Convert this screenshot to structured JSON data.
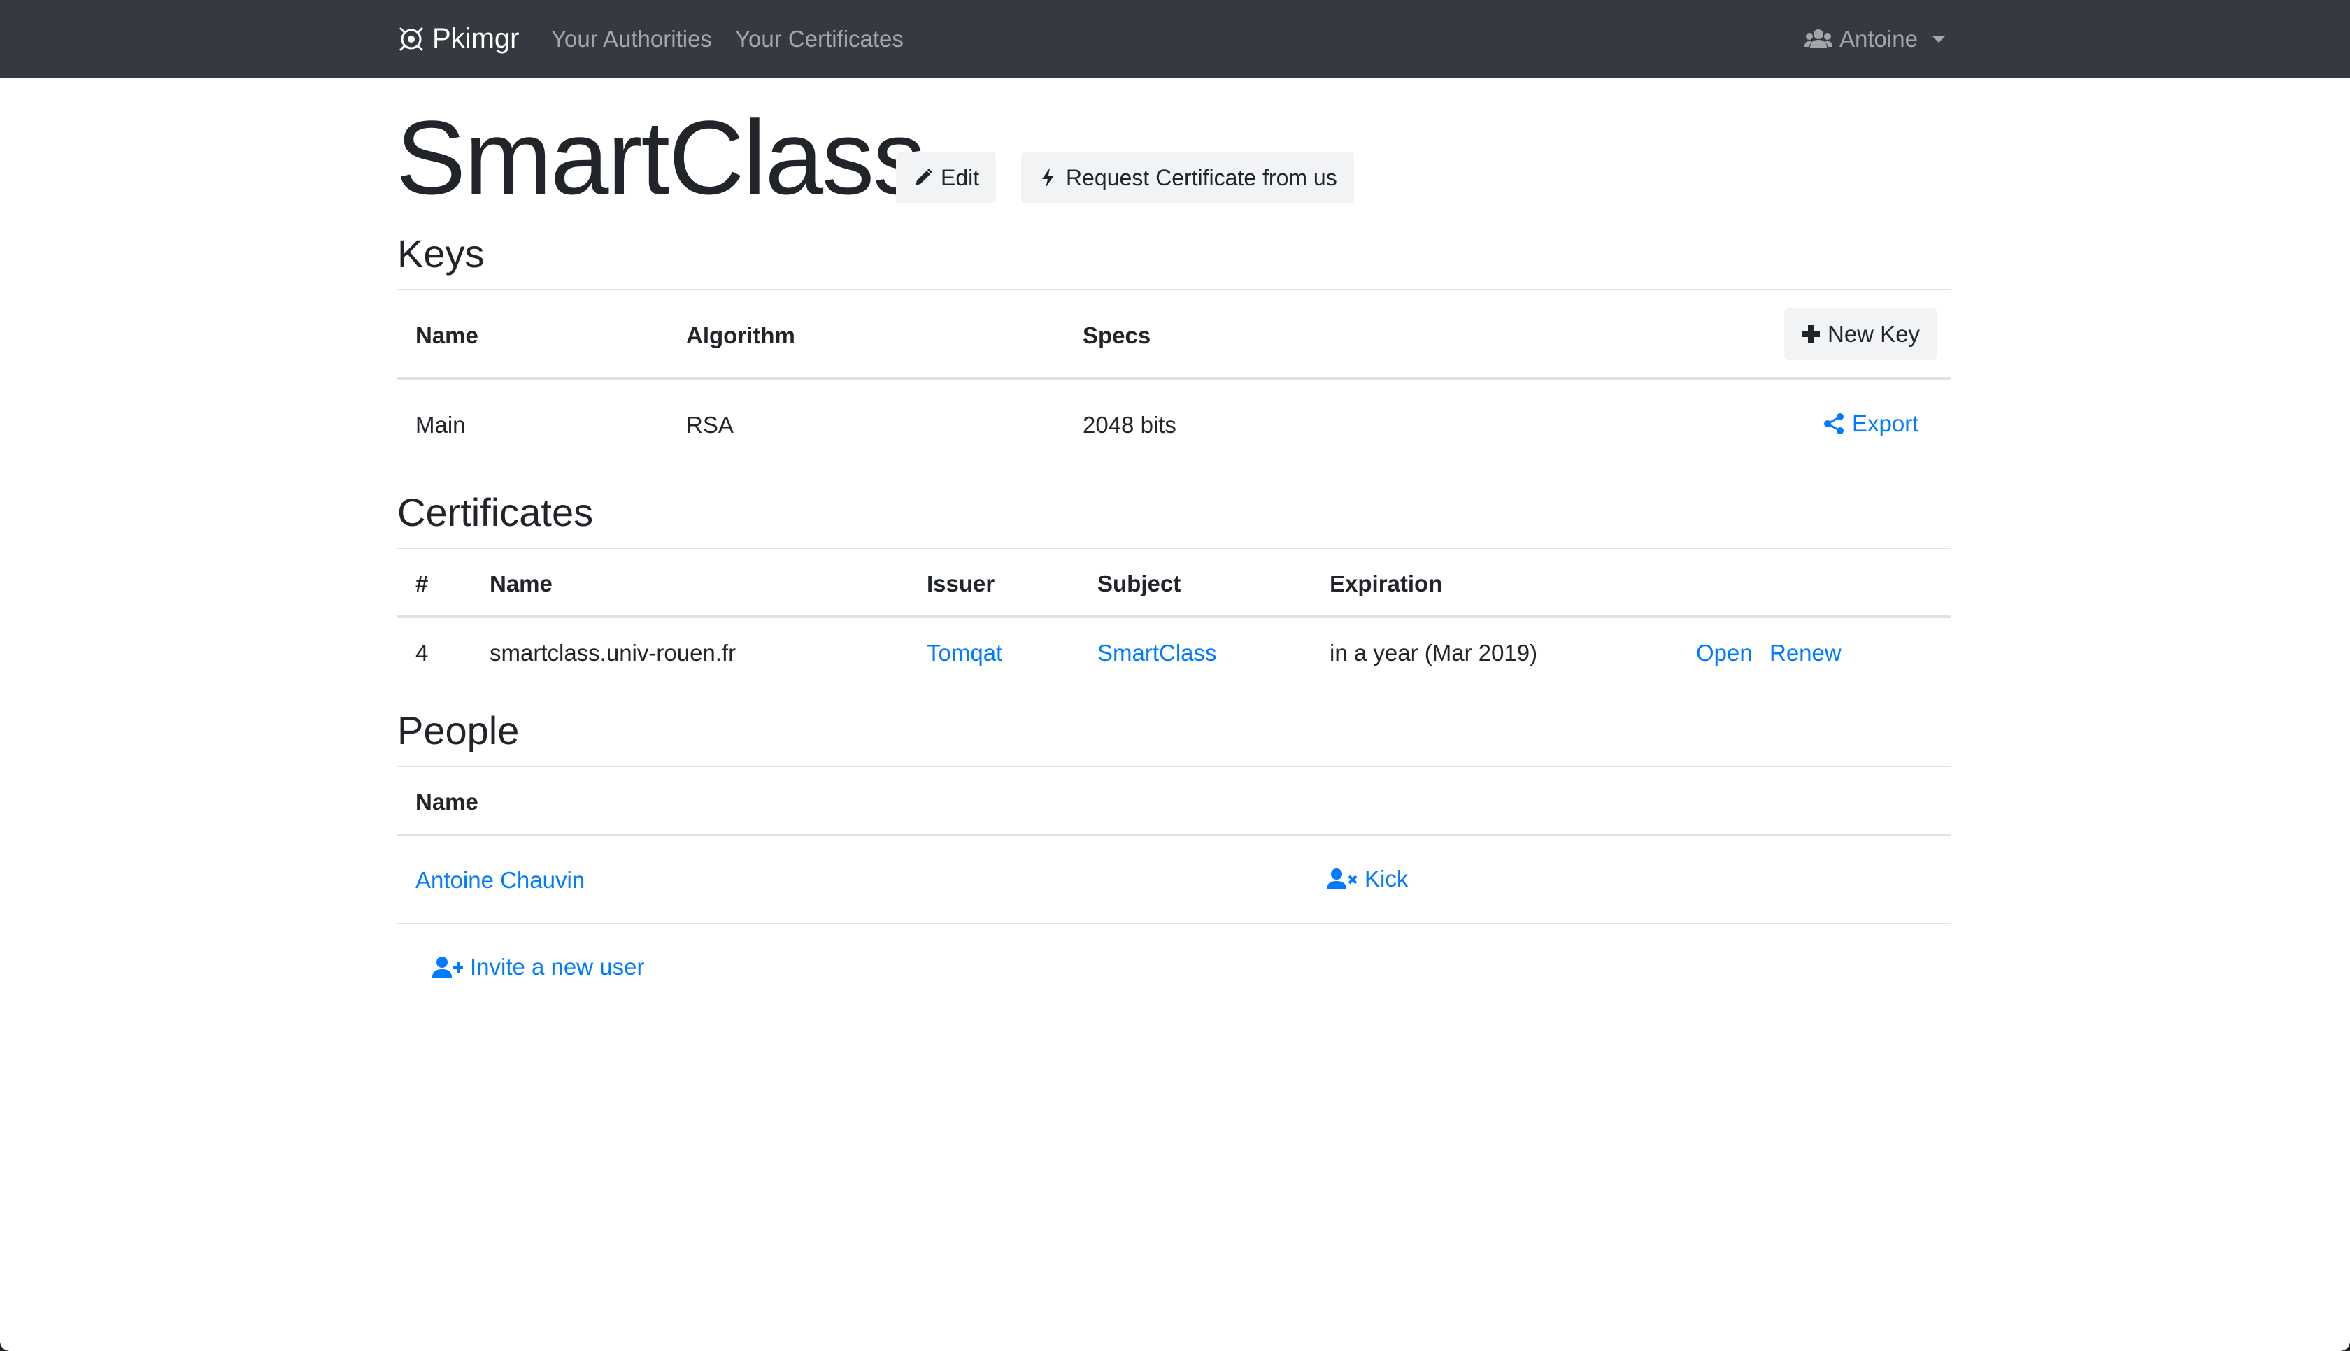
{
  "navbar": {
    "brand": "Pkimgr",
    "links": [
      "Your Authorities",
      "Your Certificates"
    ],
    "user": "Antoine"
  },
  "page": {
    "title": "SmartClass",
    "edit_label": "Edit",
    "request_label": "Request Certificate from us"
  },
  "keys": {
    "heading": "Keys",
    "columns": [
      "Name",
      "Algorithm",
      "Specs"
    ],
    "new_key_label": "New Key",
    "rows": [
      {
        "name": "Main",
        "algorithm": "RSA",
        "specs": "2048 bits",
        "action": "Export"
      }
    ]
  },
  "certificates": {
    "heading": "Certificates",
    "columns": [
      "#",
      "Name",
      "Issuer",
      "Subject",
      "Expiration"
    ],
    "rows": [
      {
        "number": "4",
        "name": "smartclass.univ-rouen.fr",
        "issuer": "Tomqat",
        "subject": "SmartClass",
        "expiration": "in a year (Mar 2019)",
        "open": "Open",
        "renew": "Renew"
      }
    ]
  },
  "people": {
    "heading": "People",
    "columns": [
      "Name"
    ],
    "rows": [
      {
        "name": "Antoine Chauvin",
        "action": "Kick"
      }
    ],
    "invite_label": "Invite a new user"
  },
  "icons": {
    "brand": "robot-icon",
    "user_menu": "users-icon",
    "edit": "pencil-icon",
    "request": "bolt-icon",
    "new_key": "plus-icon",
    "export": "share-icon",
    "kick": "user-times-icon",
    "invite": "user-plus-icon"
  },
  "colors": {
    "navbar": "#343a40",
    "link": "#007bff",
    "button_bg": "#f1f3f5"
  }
}
